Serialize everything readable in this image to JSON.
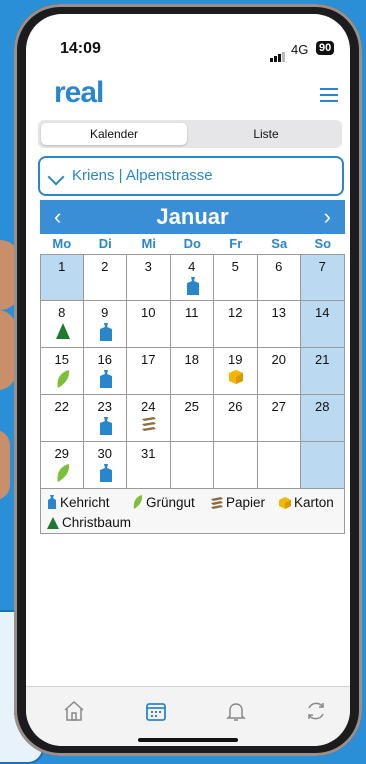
{
  "status": {
    "time": "14:09",
    "network": "4G",
    "battery": "90"
  },
  "app": {
    "logo": "real"
  },
  "segments": {
    "calendar": "Kalender",
    "list": "Liste"
  },
  "location": {
    "label": "Kriens | Alpenstrasse"
  },
  "calendar": {
    "month": "Januar",
    "weekdays": [
      "Mo",
      "Di",
      "Mi",
      "Do",
      "Fr",
      "Sa",
      "So"
    ],
    "days": [
      {
        "n": "1",
        "icon": null
      },
      {
        "n": "2",
        "icon": null
      },
      {
        "n": "3",
        "icon": null
      },
      {
        "n": "4",
        "icon": "kehricht"
      },
      {
        "n": "5",
        "icon": null
      },
      {
        "n": "6",
        "icon": null
      },
      {
        "n": "7",
        "icon": null
      },
      {
        "n": "8",
        "icon": "christbaum"
      },
      {
        "n": "9",
        "icon": "kehricht"
      },
      {
        "n": "10",
        "icon": null
      },
      {
        "n": "11",
        "icon": null
      },
      {
        "n": "12",
        "icon": null
      },
      {
        "n": "13",
        "icon": null
      },
      {
        "n": "14",
        "icon": null
      },
      {
        "n": "15",
        "icon": "gruengut"
      },
      {
        "n": "16",
        "icon": "kehricht"
      },
      {
        "n": "17",
        "icon": null
      },
      {
        "n": "18",
        "icon": null
      },
      {
        "n": "19",
        "icon": "karton"
      },
      {
        "n": "20",
        "icon": null
      },
      {
        "n": "21",
        "icon": null
      },
      {
        "n": "22",
        "icon": null
      },
      {
        "n": "23",
        "icon": "kehricht"
      },
      {
        "n": "24",
        "icon": "papier"
      },
      {
        "n": "25",
        "icon": null
      },
      {
        "n": "26",
        "icon": null
      },
      {
        "n": "27",
        "icon": null
      },
      {
        "n": "28",
        "icon": null
      },
      {
        "n": "29",
        "icon": "gruengut"
      },
      {
        "n": "30",
        "icon": "kehricht"
      },
      {
        "n": "31",
        "icon": null
      },
      {
        "n": "",
        "icon": null
      },
      {
        "n": "",
        "icon": null
      },
      {
        "n": "",
        "icon": null
      },
      {
        "n": "",
        "icon": null
      }
    ]
  },
  "legend": {
    "kehricht": "Kehricht",
    "gruengut": "Grüngut",
    "papier": "Papier",
    "karton": "Karton",
    "christbaum": "Christbaum"
  },
  "colors": {
    "accent": "#2a86cc",
    "weekend": "#bcd9f2",
    "tree": "#1e7a2e",
    "leaf": "#7cbf3a",
    "box": "#f2b705"
  }
}
